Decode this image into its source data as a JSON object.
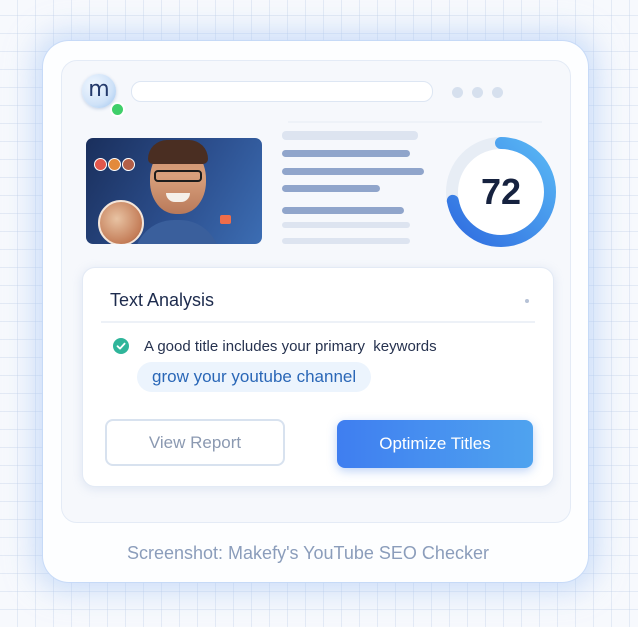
{
  "browser": {
    "logo_mark": "m",
    "status": "online"
  },
  "thumbnail": {
    "description_icon": "creator-face"
  },
  "score": {
    "value": 72,
    "fraction": 0.72,
    "colors": {
      "start": "#2f6ce0",
      "end": "#59b8f5",
      "track": "#e7edf5"
    }
  },
  "text_analysis": {
    "title": "Text Analysis",
    "tip": "A good title includes your primary  keywords",
    "keyword": "grow your youtube channel",
    "buttons": {
      "view_report": "View Report",
      "optimize_titles": "Optimize Titles"
    }
  },
  "caption": "Screenshot: Makefy's YouTube SEO Checker",
  "colors": {
    "accent": "#3f7ef0",
    "success": "#2fb59a",
    "online": "#3fcf6a"
  }
}
